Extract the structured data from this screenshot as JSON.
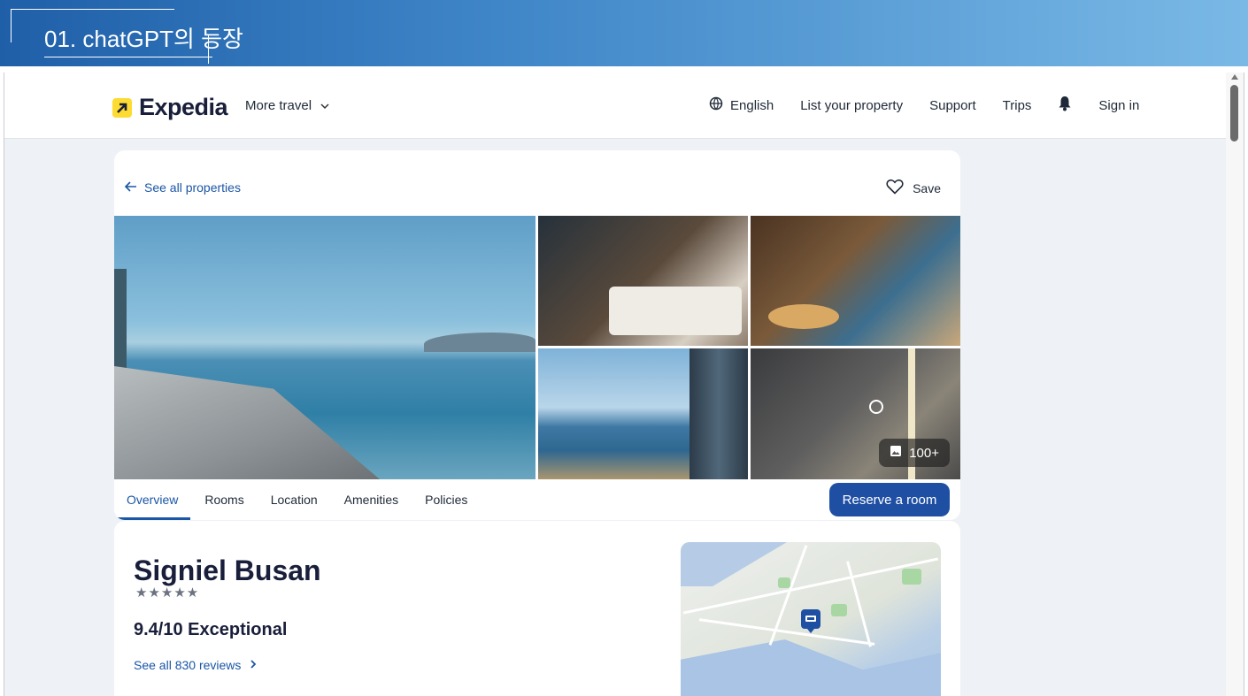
{
  "slide": {
    "title": "01. chatGPT의 등장"
  },
  "nav": {
    "brand": "Expedia",
    "more_travel": "More travel",
    "language": "English",
    "list_property": "List your property",
    "support": "Support",
    "trips": "Trips",
    "sign_in": "Sign in"
  },
  "property": {
    "back_link": "See all properties",
    "save_label": "Save",
    "photo_count": "100+",
    "tabs": [
      "Overview",
      "Rooms",
      "Location",
      "Amenities",
      "Policies"
    ],
    "active_tab": "Overview",
    "reserve_label": "Reserve a room",
    "name": "Signiel Busan",
    "stars": "★★★★★",
    "star_rating": 5,
    "rating": "9.4/10 Exceptional",
    "reviews_link": "See all 830 reviews"
  },
  "colors": {
    "brand_yellow": "#fddb32",
    "primary_blue": "#1f4fa3",
    "link_blue": "#1a56a6",
    "header_band": "#3f86c8"
  },
  "icons": [
    "arrow-up-right-icon",
    "chevron-down-icon",
    "globe-icon",
    "bell-icon",
    "arrow-left-icon",
    "heart-icon",
    "image-icon",
    "chevron-right-icon",
    "map-pin-icon"
  ]
}
